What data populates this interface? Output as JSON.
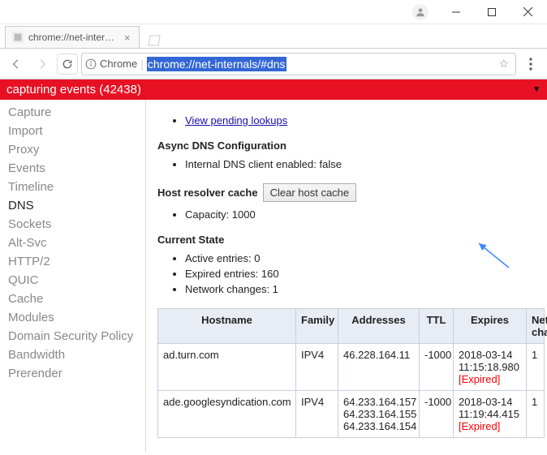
{
  "titlebar": {},
  "tab": {
    "title": "chrome://net-internals/#"
  },
  "toolbar": {
    "chip_label": "Chrome",
    "url": "chrome://net-internals/#dns"
  },
  "banner": {
    "text": "capturing events (42438)"
  },
  "sidebar": {
    "items": [
      {
        "label": "Capture",
        "active": false
      },
      {
        "label": "Import",
        "active": false
      },
      {
        "label": "Proxy",
        "active": false
      },
      {
        "label": "Events",
        "active": false
      },
      {
        "label": "Timeline",
        "active": false
      },
      {
        "label": "DNS",
        "active": true
      },
      {
        "label": "Sockets",
        "active": false
      },
      {
        "label": "Alt-Svc",
        "active": false
      },
      {
        "label": "HTTP/2",
        "active": false
      },
      {
        "label": "QUIC",
        "active": false
      },
      {
        "label": "Cache",
        "active": false
      },
      {
        "label": "Modules",
        "active": false
      },
      {
        "label": "Domain Security Policy",
        "active": false
      },
      {
        "label": "Bandwidth",
        "active": false
      },
      {
        "label": "Prerender",
        "active": false
      }
    ]
  },
  "content": {
    "pending_link": "View pending lookups",
    "async_head": "Async DNS Configuration",
    "async_item": "Internal DNS client enabled: false",
    "cache_label": "Host resolver cache",
    "cache_button": "Clear host cache",
    "capacity": "Capacity: 1000",
    "state_head": "Current State",
    "state_items": [
      "Active entries: 0",
      "Expired entries: 160",
      "Network changes: 1"
    ],
    "table": {
      "headers": [
        "Hostname",
        "Family",
        "Addresses",
        "TTL",
        "Expires",
        "Network changes"
      ],
      "rows": [
        {
          "hostname": "ad.turn.com",
          "family": "IPV4",
          "addresses": "46.228.164.11",
          "ttl": "-1000",
          "expires": {
            "ts": "2018-03-14 11:15:18.980",
            "expired": "[Expired]"
          },
          "nc": "1"
        },
        {
          "hostname": "ade.googlesyndication.com",
          "family": "IPV4",
          "addresses": "64.233.164.157\n64.233.164.155\n64.233.164.154",
          "ttl": "-1000",
          "expires": {
            "ts": "2018-03-14 11:19:44.415",
            "expired": "[Expired]"
          },
          "nc": "1"
        }
      ]
    }
  }
}
